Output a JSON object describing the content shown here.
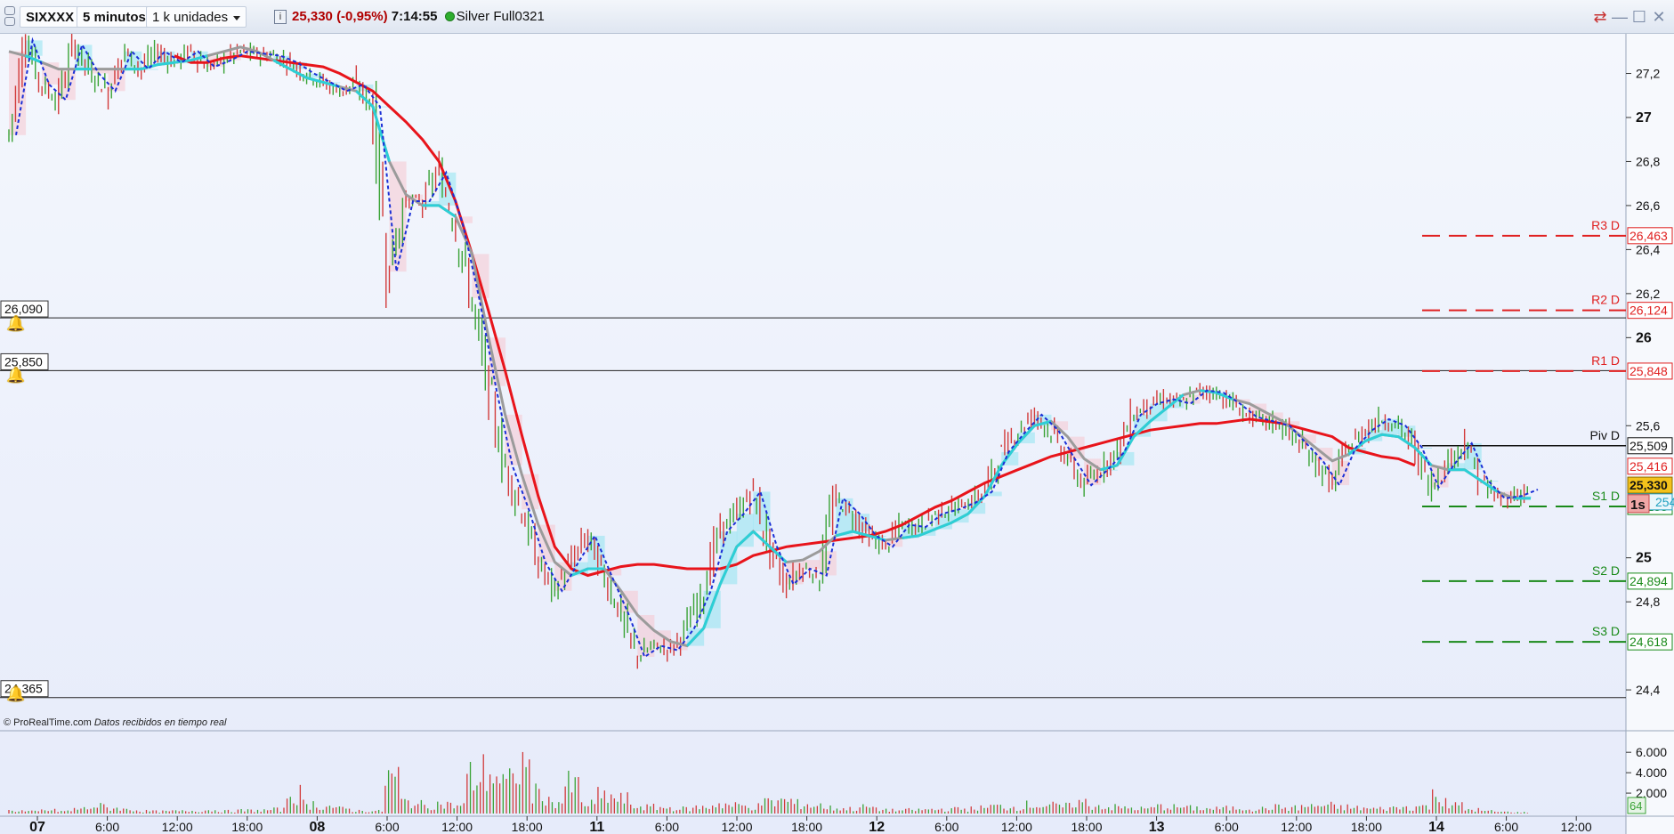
{
  "toolbar": {
    "symbol": "SIXXXX",
    "timeframe": "5 minutos",
    "units": "1 k unidades",
    "info_icon": "info-icon",
    "price": "25,330",
    "change": "(-0,95%)",
    "time": "7:14:55",
    "instrument": "Silver Full0321",
    "status_color": "#2eae2e"
  },
  "window_controls": [
    "sync-icon",
    "minimize-icon",
    "maximize-icon",
    "close-icon"
  ],
  "alerts": [
    {
      "label": "26,090",
      "price": 26.09
    },
    {
      "label": "25,850",
      "price": 25.85
    },
    {
      "label": "24,365",
      "price": 24.365
    }
  ],
  "credit": {
    "site": "© ProRealTime.com",
    "note": "Datos recibidos en tiempo real"
  },
  "chart_data": {
    "type": "line",
    "ylim": [
      24.275,
      27.38
    ],
    "y_ticks": [
      {
        "v": 27.2,
        "t": "27,2",
        "bold": false
      },
      {
        "v": 27.0,
        "t": "27",
        "bold": true
      },
      {
        "v": 26.8,
        "t": "26,8",
        "bold": false
      },
      {
        "v": 26.6,
        "t": "26,6",
        "bold": false
      },
      {
        "v": 26.4,
        "t": "26,4",
        "bold": false
      },
      {
        "v": 26.2,
        "t": "26,2",
        "bold": false
      },
      {
        "v": 26.0,
        "t": "26",
        "bold": true
      },
      {
        "v": 25.6,
        "t": "25,6",
        "bold": false
      },
      {
        "v": 25.0,
        "t": "25",
        "bold": true
      },
      {
        "v": 24.8,
        "t": "24,8",
        "bold": false
      },
      {
        "v": 24.4,
        "t": "24,4",
        "bold": false
      }
    ],
    "x_ticks": [
      {
        "t": "07",
        "bold": true
      },
      {
        "t": "6:00",
        "bold": false
      },
      {
        "t": "12:00",
        "bold": false
      },
      {
        "t": "18:00",
        "bold": false
      },
      {
        "t": "08",
        "bold": true
      },
      {
        "t": "6:00",
        "bold": false
      },
      {
        "t": "12:00",
        "bold": false
      },
      {
        "t": "18:00",
        "bold": false
      },
      {
        "t": "11",
        "bold": true
      },
      {
        "t": "6:00",
        "bold": false
      },
      {
        "t": "12:00",
        "bold": false
      },
      {
        "t": "18:00",
        "bold": false
      },
      {
        "t": "12",
        "bold": true
      },
      {
        "t": "6:00",
        "bold": false
      },
      {
        "t": "12:00",
        "bold": false
      },
      {
        "t": "18:00",
        "bold": false
      },
      {
        "t": "13",
        "bold": true
      },
      {
        "t": "6:00",
        "bold": false
      },
      {
        "t": "12:00",
        "bold": false
      },
      {
        "t": "18:00",
        "bold": false
      },
      {
        "t": "14",
        "bold": true
      },
      {
        "t": "6:00",
        "bold": false
      },
      {
        "t": "12:00",
        "bold": false
      }
    ],
    "pivots": [
      {
        "name": "R3 D",
        "value": 26.463,
        "label": "26,463",
        "color": "#e02020",
        "style": "dash"
      },
      {
        "name": "R2 D",
        "value": 26.124,
        "label": "26,124",
        "color": "#e02020",
        "style": "dash"
      },
      {
        "name": "R1 D",
        "value": 25.848,
        "label": "25,848",
        "color": "#e02020",
        "style": "dash"
      },
      {
        "name": "Piv D",
        "value": 25.509,
        "label": "25,509",
        "color": "#111111",
        "style": "solid"
      },
      {
        "name": "S1 D",
        "value": 25.233,
        "label": "25,233",
        "color": "#1a8a1a",
        "style": "dash"
      },
      {
        "name": "S2 D",
        "value": 24.894,
        "label": "24,894",
        "color": "#1a8a1a",
        "style": "dash"
      },
      {
        "name": "S3 D",
        "value": 24.618,
        "label": "24,618",
        "color": "#1a8a1a",
        "style": "dash"
      }
    ],
    "markers": [
      {
        "value": 25.416,
        "label": "25,416",
        "color": "#e02020",
        "bg": "#ffffff"
      },
      {
        "value": 25.33,
        "label": "25,330",
        "color": "#111111",
        "bg": "#f3c21b"
      },
      {
        "value": 25.254,
        "label": "254",
        "color": "#20a0c0",
        "bg": "#e9f6fb"
      }
    ],
    "countdown": "1s",
    "close_series": [
      26.92,
      27.35,
      27.15,
      27.08,
      27.33,
      27.2,
      27.12,
      27.3,
      27.22,
      27.3,
      27.25,
      27.3,
      27.23,
      27.26,
      27.3,
      27.29,
      27.28,
      27.25,
      27.2,
      27.16,
      27.12,
      27.15,
      27.05,
      26.3,
      26.62,
      26.62,
      26.75,
      26.52,
      26.18,
      25.78,
      25.42,
      25.22,
      24.98,
      24.85,
      24.98,
      25.1,
      24.92,
      24.75,
      24.55,
      24.6,
      24.58,
      24.68,
      24.85,
      25.12,
      25.2,
      25.3,
      25.05,
      24.88,
      24.95,
      24.92,
      25.27,
      25.2,
      25.1,
      25.05,
      25.15,
      25.14,
      25.2,
      25.22,
      25.25,
      25.3,
      25.48,
      25.57,
      25.65,
      25.58,
      25.45,
      25.33,
      25.4,
      25.48,
      25.65,
      25.7,
      25.72,
      25.7,
      25.76,
      25.75,
      25.7,
      25.64,
      25.62,
      25.6,
      25.52,
      25.44,
      25.33,
      25.5,
      25.58,
      25.63,
      25.6,
      25.5,
      25.32,
      25.43,
      25.52,
      25.35,
      25.27,
      25.28,
      25.31
    ],
    "ma_gray": [
      27.3,
      27.28,
      27.25,
      27.22,
      27.22,
      27.22,
      27.22,
      27.22,
      27.22,
      27.24,
      27.25,
      27.26,
      27.28,
      27.3,
      27.32,
      27.3,
      27.26,
      27.22,
      27.18,
      27.16,
      27.14,
      27.12,
      27.05,
      26.8,
      26.65,
      26.6,
      26.6,
      26.55,
      26.38,
      26.0,
      25.65,
      25.38,
      25.15,
      24.98,
      24.92,
      24.95,
      24.95,
      24.85,
      24.74,
      24.67,
      24.62,
      24.6,
      24.68,
      24.88,
      25.05,
      25.12,
      25.05,
      24.98,
      24.99,
      25.03,
      25.1,
      25.12,
      25.1,
      25.08,
      25.09,
      25.1,
      25.13,
      25.16,
      25.2,
      25.28,
      25.42,
      25.52,
      25.6,
      25.62,
      25.55,
      25.45,
      25.4,
      25.42,
      25.55,
      25.62,
      25.68,
      25.74,
      25.76,
      25.75,
      25.72,
      25.7,
      25.66,
      25.62,
      25.56,
      25.5,
      25.44,
      25.47,
      25.53,
      25.56,
      25.55,
      25.5,
      25.42,
      25.4,
      25.4,
      25.35,
      25.3,
      25.27,
      25.27
    ],
    "ma_red": [
      null,
      null,
      null,
      null,
      null,
      null,
      null,
      null,
      null,
      null,
      27.28,
      27.25,
      27.25,
      27.27,
      27.28,
      27.27,
      27.26,
      27.25,
      27.24,
      27.23,
      27.2,
      27.16,
      27.12,
      27.05,
      26.98,
      26.9,
      26.8,
      26.62,
      26.38,
      26.12,
      25.85,
      25.56,
      25.28,
      25.05,
      24.95,
      24.92,
      24.94,
      24.96,
      24.97,
      24.97,
      24.96,
      24.95,
      24.95,
      24.95,
      24.97,
      25.01,
      25.03,
      25.05,
      25.06,
      25.07,
      25.08,
      25.09,
      25.1,
      25.12,
      25.15,
      25.19,
      25.23,
      25.26,
      25.3,
      25.34,
      25.37,
      25.4,
      25.43,
      25.46,
      25.48,
      25.5,
      25.52,
      25.54,
      25.56,
      25.58,
      25.59,
      25.6,
      25.61,
      25.61,
      25.62,
      25.63,
      25.62,
      25.61,
      25.59,
      25.57,
      25.55,
      25.5,
      25.48,
      25.46,
      25.45,
      25.42
    ],
    "volume_ylim": [
      0,
      7500
    ],
    "volume_ticks": [
      {
        "v": 6000,
        "t": "6.000"
      },
      {
        "v": 4000,
        "t": "4.000"
      },
      {
        "v": 2000,
        "t": "2.000"
      }
    ],
    "volume_last": "64",
    "volume_series": [
      350,
      250,
      400,
      300,
      600,
      900,
      700,
      500,
      300,
      260,
      300,
      350,
      420,
      300,
      380,
      400,
      500,
      2500,
      1200,
      900,
      600,
      350,
      300,
      4500,
      1500,
      1100,
      1200,
      1000,
      4600,
      5200,
      3800,
      6000,
      2500,
      1500,
      3500,
      1200,
      2200,
      1800,
      900,
      800,
      700,
      600,
      800,
      1200,
      1000,
      900,
      1400,
      1600,
      1200,
      1000,
      700,
      600,
      800,
      500,
      400,
      450,
      500,
      550,
      600,
      700,
      900,
      800,
      1100,
      1000,
      900,
      1400,
      1000,
      800,
      700,
      600,
      900,
      800,
      700,
      600,
      650,
      700,
      600,
      800,
      700,
      900,
      1000,
      800,
      700,
      600,
      700,
      800,
      900,
      2200,
      1000,
      500,
      300,
      200,
      150
    ]
  }
}
